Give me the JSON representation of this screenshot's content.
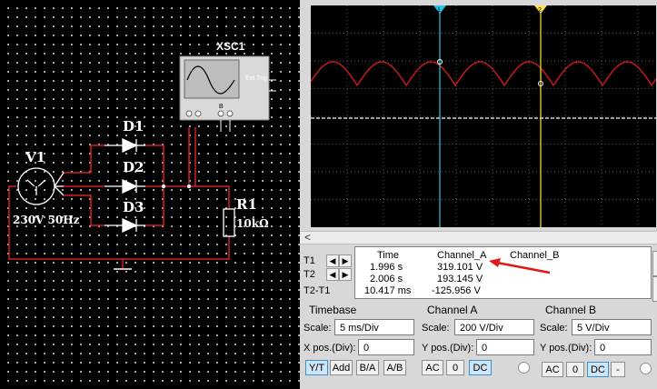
{
  "circuit": {
    "source_label": "V1",
    "source_value": "230V 50Hz",
    "diodes": [
      "D1",
      "D2",
      "D3"
    ],
    "resistor_label": "R1",
    "resistor_value": "10kΩ",
    "scope_label": "XSC1",
    "scope_pins": {
      "ext_trig": "Ext Trig",
      "channel_b": "B"
    }
  },
  "oscilloscope": {
    "cursor_colors": {
      "t1": "#29c5e6",
      "t2": "#ffe24a"
    },
    "trace_color": "#c51a1a",
    "readout": {
      "headers": {
        "time": "Time",
        "channel_a": "Channel_A",
        "channel_b": "Channel_B"
      },
      "rows": [
        {
          "label": "T1",
          "time": "1.996 s",
          "channel_a": "319.101 V",
          "channel_b": ""
        },
        {
          "label": "T2",
          "time": "2.006 s",
          "channel_a": "193.145 V",
          "channel_b": ""
        },
        {
          "label": "T2-T1",
          "time": "10.417 ms",
          "channel_a": "-125.956 V",
          "channel_b": ""
        }
      ],
      "annotation_color": "#e01818"
    },
    "timebase": {
      "title": "Timebase",
      "scale_label": "Scale:",
      "scale_value": "5 ms/Div",
      "xpos_label": "X pos.(Div):",
      "xpos_value": "0",
      "buttons": [
        "Y/T",
        "Add",
        "B/A",
        "A/B"
      ],
      "active_button": "Y/T"
    },
    "channel_a": {
      "title": "Channel A",
      "scale_label": "Scale:",
      "scale_value": "200  V/Div",
      "ypos_label": "Y pos.(Div):",
      "ypos_value": "0",
      "buttons": [
        "AC",
        "0",
        "DC"
      ],
      "active_button": "DC"
    },
    "channel_b": {
      "title": "Channel B",
      "scale_label": "Scale:",
      "scale_value": "5  V/Div",
      "ypos_label": "Y pos.(Div):",
      "ypos_value": "0",
      "buttons": [
        "AC",
        "0",
        "DC",
        "-"
      ],
      "active_button": "DC"
    }
  }
}
